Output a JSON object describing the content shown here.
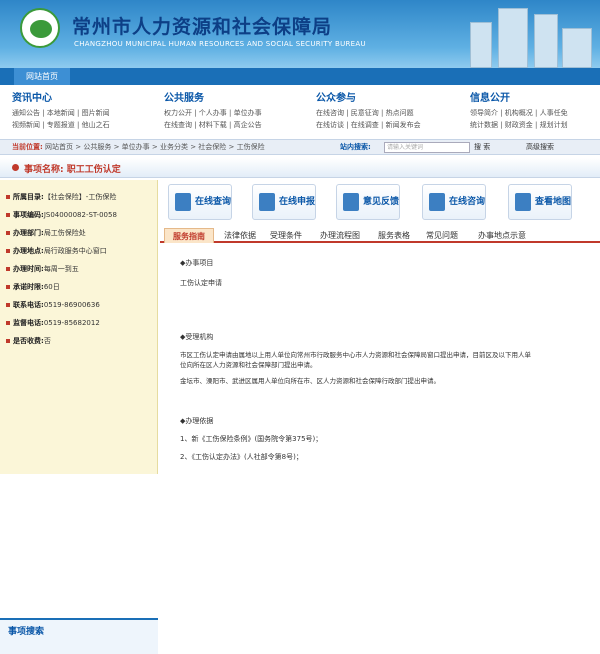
{
  "header": {
    "title_cn": "常州市人力资源和社会保障局",
    "title_en": "CHANGZHOU MUNICIPAL HUMAN RESOURCES AND SOCIAL SECURITY BUREAU"
  },
  "nav": {
    "home": "网站首页"
  },
  "menu": [
    {
      "title": "资讯中心",
      "rows": [
        "通知公告 | 本地新闻 | 图片新闻",
        "视频新闻 | 专题报道 | 他山之石"
      ]
    },
    {
      "title": "公共服务",
      "rows": [
        "权力公开 | 个人办事 | 单位办事",
        "在线查询 | 材料下载 | 高企公告"
      ]
    },
    {
      "title": "公众参与",
      "rows": [
        "在线咨询 | 民意征询 | 热点问题",
        "在线访谈 | 在线调查 | 新闻发布会"
      ]
    },
    {
      "title": "信息公开",
      "rows": [
        "领导简介 | 机构概况 | 人事任免",
        "统计数据 | 财政资金 | 规划计划"
      ]
    }
  ],
  "breadcrumb": {
    "label": "当前位置:",
    "path": "网站首页 > 公共服务 > 单位办事 > 业务分类 > 社会保险 > 工伤保险",
    "search_label": "站内搜索:",
    "search_placeholder": "请输入关键词",
    "search_btn": "搜 索",
    "advanced": "高级搜索"
  },
  "item": {
    "title": "事项名称: 职工工伤认定"
  },
  "info": [
    {
      "k": "所属目录:",
      "v": "【社会保险】-工伤保险"
    },
    {
      "k": "事项编码:",
      "v": "JS04000082-ST-0058"
    },
    {
      "k": "办理部门:",
      "v": "局工伤保险处"
    },
    {
      "k": "办理地点:",
      "v": "局行政服务中心窗口"
    },
    {
      "k": "办理时间:",
      "v": "每周一到五"
    },
    {
      "k": "承诺时限:",
      "v": "60日"
    },
    {
      "k": "联系电话:",
      "v": "0519-86900636"
    },
    {
      "k": "监督电话:",
      "v": "0519-85682012"
    },
    {
      "k": "是否收费:",
      "v": "否"
    }
  ],
  "search_panel": {
    "title": "事项搜索"
  },
  "actions": [
    "在线查询",
    "在线申报",
    "意见反馈",
    "在线咨询",
    "查看地图"
  ],
  "tabs": [
    "服务指南",
    "法律依据",
    "受理条件",
    "办理流程图",
    "服务表格",
    "常见问题",
    "办事地点示意"
  ],
  "content": {
    "s1": "◆办事项目",
    "s1v": "工伤认定申请",
    "s2": "◆受理机构",
    "s2a": "市区工伤认定申请由属地以上用人单位向常州市行政服务中心市人力资源和社会保障局窗口提出申请，目前区及以下用人单",
    "s2b": "位向所在区人力资源和社会保障部门提出申请。",
    "s2c": "金坛市、溧阳市、武进区属用人单位向所在市、区人力资源和社会保障行政部门提出申请。",
    "s3": "◆办理依据",
    "s3a": "1、新《工伤保险条例》(国务院令第375号)；",
    "s3b": "2、《工伤认定办法》(人社部令第8号)；"
  }
}
